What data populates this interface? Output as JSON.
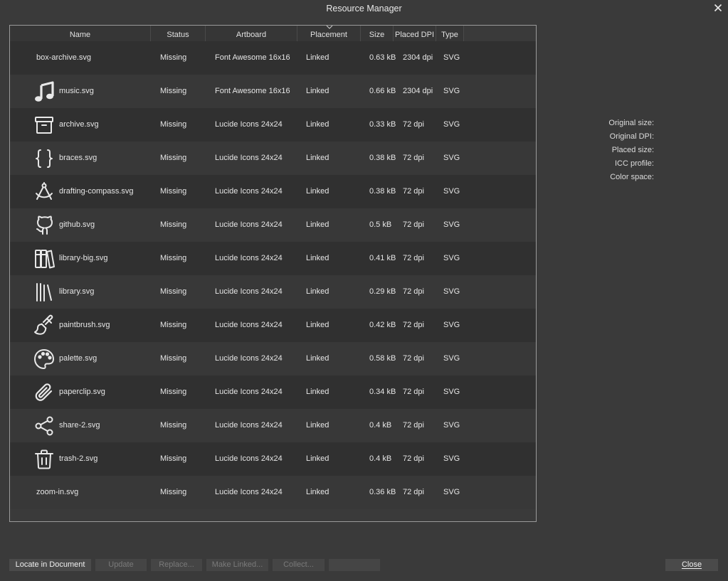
{
  "window": {
    "title": "Resource Manager"
  },
  "table": {
    "columns": [
      "Name",
      "Status",
      "Artboard",
      "Placement",
      "Size",
      "Placed DPI",
      "Type"
    ],
    "rows": [
      {
        "name": "box-archive.svg",
        "icon": "none",
        "status": "Missing",
        "artboard": "Font Awesome 16x16",
        "placement": "Linked",
        "size": "0.63 kB",
        "dpi": "2304 dpi",
        "type": "SVG"
      },
      {
        "name": "music.svg",
        "icon": "music-icon",
        "status": "Missing",
        "artboard": "Font Awesome 16x16",
        "placement": "Linked",
        "size": "0.66 kB",
        "dpi": "2304 dpi",
        "type": "SVG"
      },
      {
        "name": "archive.svg",
        "icon": "archive-icon",
        "status": "Missing",
        "artboard": "Lucide Icons 24x24",
        "placement": "Linked",
        "size": "0.33 kB",
        "dpi": "72 dpi",
        "type": "SVG"
      },
      {
        "name": "braces.svg",
        "icon": "braces-icon",
        "status": "Missing",
        "artboard": "Lucide Icons 24x24",
        "placement": "Linked",
        "size": "0.38 kB",
        "dpi": "72 dpi",
        "type": "SVG"
      },
      {
        "name": "drafting-compass.svg",
        "icon": "drafting-compass-icon",
        "status": "Missing",
        "artboard": "Lucide Icons 24x24",
        "placement": "Linked",
        "size": "0.38 kB",
        "dpi": "72 dpi",
        "type": "SVG"
      },
      {
        "name": "github.svg",
        "icon": "github-icon",
        "status": "Missing",
        "artboard": "Lucide Icons 24x24",
        "placement": "Linked",
        "size": "0.5 kB",
        "dpi": "72 dpi",
        "type": "SVG"
      },
      {
        "name": "library-big.svg",
        "icon": "library-big-icon",
        "status": "Missing",
        "artboard": "Lucide Icons 24x24",
        "placement": "Linked",
        "size": "0.41 kB",
        "dpi": "72 dpi",
        "type": "SVG"
      },
      {
        "name": "library.svg",
        "icon": "library-icon",
        "status": "Missing",
        "artboard": "Lucide Icons 24x24",
        "placement": "Linked",
        "size": "0.29 kB",
        "dpi": "72 dpi",
        "type": "SVG"
      },
      {
        "name": "paintbrush.svg",
        "icon": "paintbrush-icon",
        "status": "Missing",
        "artboard": "Lucide Icons 24x24",
        "placement": "Linked",
        "size": "0.42 kB",
        "dpi": "72 dpi",
        "type": "SVG"
      },
      {
        "name": "palette.svg",
        "icon": "palette-icon",
        "status": "Missing",
        "artboard": "Lucide Icons 24x24",
        "placement": "Linked",
        "size": "0.58 kB",
        "dpi": "72 dpi",
        "type": "SVG"
      },
      {
        "name": "paperclip.svg",
        "icon": "paperclip-icon",
        "status": "Missing",
        "artboard": "Lucide Icons 24x24",
        "placement": "Linked",
        "size": "0.34 kB",
        "dpi": "72 dpi",
        "type": "SVG"
      },
      {
        "name": "share-2.svg",
        "icon": "share-2-icon",
        "status": "Missing",
        "artboard": "Lucide Icons 24x24",
        "placement": "Linked",
        "size": "0.4 kB",
        "dpi": "72 dpi",
        "type": "SVG"
      },
      {
        "name": "trash-2.svg",
        "icon": "trash-2-icon",
        "status": "Missing",
        "artboard": "Lucide Icons 24x24",
        "placement": "Linked",
        "size": "0.4 kB",
        "dpi": "72 dpi",
        "type": "SVG"
      },
      {
        "name": "zoom-in.svg",
        "icon": "none",
        "status": "Missing",
        "artboard": "Lucide Icons 24x24",
        "placement": "Linked",
        "size": "0.36 kB",
        "dpi": "72 dpi",
        "type": "SVG"
      }
    ]
  },
  "info": {
    "labels": [
      "Original size:",
      "Original DPI:",
      "Placed size:",
      "ICC profile:",
      "Color space:"
    ]
  },
  "buttons": {
    "locate": "Locate in Document",
    "update": "Update",
    "replace": "Replace...",
    "make_linked": "Make Linked...",
    "collect": "Collect...",
    "blank": "",
    "close": "Close"
  },
  "colors": {
    "background": "#3a3a3a",
    "row_odd": "#303030",
    "row_even": "#383838",
    "border": "#9a9a9a"
  }
}
